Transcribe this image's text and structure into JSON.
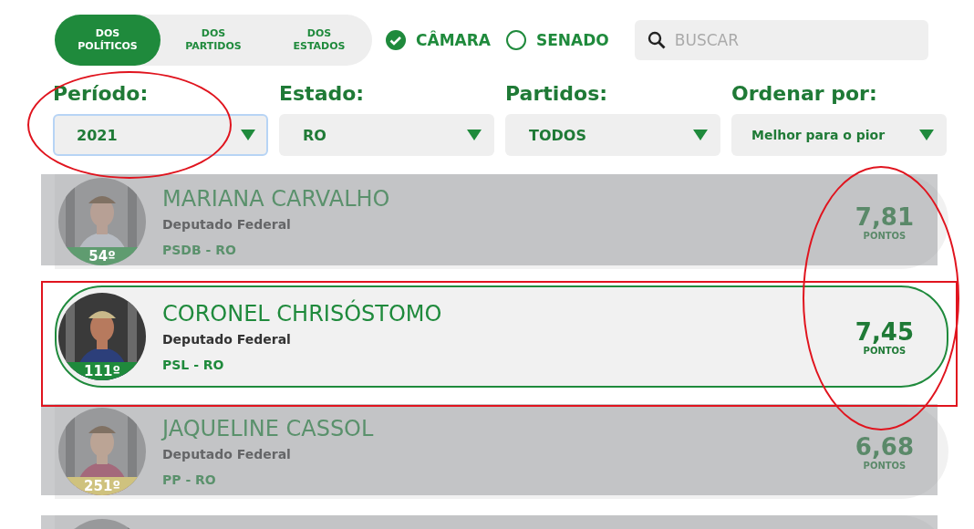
{
  "view_tabs": [
    {
      "label": "DOS POLÍTICOS",
      "selected": true
    },
    {
      "label": "DOS PARTIDOS",
      "selected": false
    },
    {
      "label": "DOS ESTADOS",
      "selected": false
    }
  ],
  "house_options": [
    {
      "label": "CÂMARA",
      "checked": true
    },
    {
      "label": "SENADO",
      "checked": false
    }
  ],
  "search": {
    "placeholder": "BUSCAR"
  },
  "filters": [
    {
      "label": "Período:",
      "value": "2021",
      "focused": true
    },
    {
      "label": "Estado:",
      "value": "RO",
      "focused": false
    },
    {
      "label": "Partidos:",
      "value": "TODOS",
      "focused": false
    },
    {
      "label": "Ordenar por:",
      "value": "Melhor para o pior",
      "focused": false
    }
  ],
  "politicians": [
    {
      "name": "MARIANA CARVALHO",
      "role": "Deputado Federal",
      "party": "PSDB - RO",
      "rank": "54º",
      "score": "7,81",
      "score_unit": "PONTOS",
      "dimmed": true,
      "highlighted": false,
      "color": "#5f9c70"
    },
    {
      "name": "CORONEL CHRISÓSTOMO",
      "role": "Deputado Federal",
      "party": "PSL - RO",
      "rank": "111º",
      "score": "7,45",
      "score_unit": "PONTOS",
      "dimmed": false,
      "highlighted": true,
      "color": "#1f8a3c"
    },
    {
      "name": "JAQUELINE CASSOL",
      "role": "Deputado Federal",
      "party": "PP - RO",
      "rank": "251º",
      "score": "6,68",
      "score_unit": "PONTOS",
      "dimmed": true,
      "highlighted": false,
      "color": "#cfc27e"
    },
    {
      "dimmed": true,
      "highlighted": false
    }
  ],
  "annotations": [
    {
      "kind": "ellipse",
      "color": "#e0141e"
    },
    {
      "kind": "ellipse",
      "color": "#e0141e"
    },
    {
      "kind": "rectangle",
      "color": "#e0141e"
    }
  ]
}
